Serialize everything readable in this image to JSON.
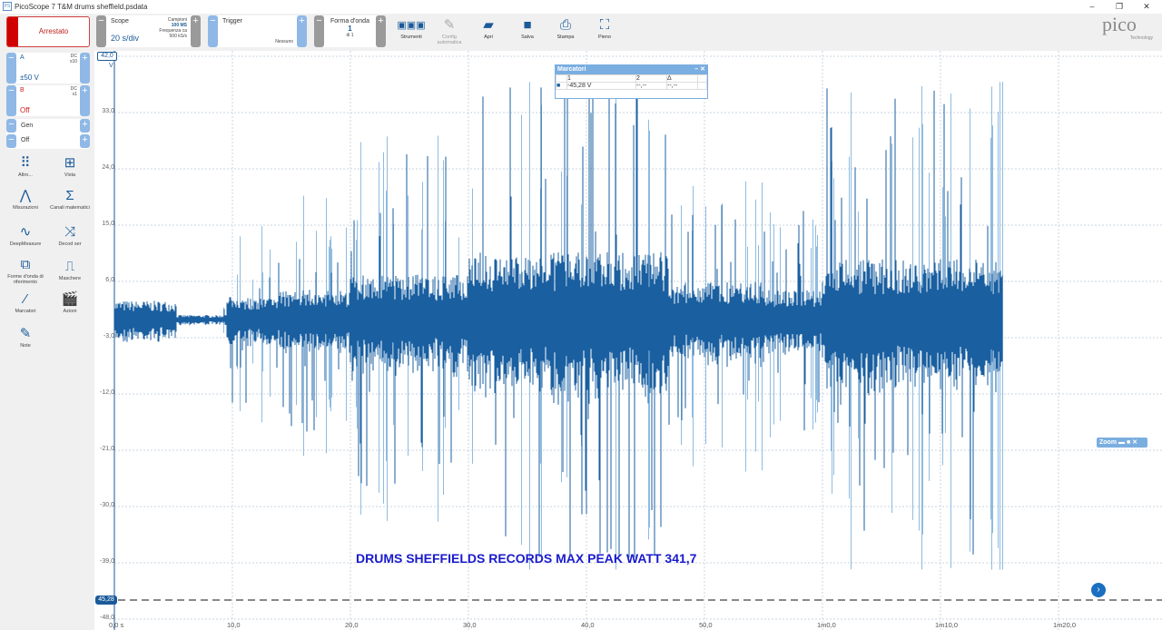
{
  "window": {
    "title": "PicoScope 7 T&M drums sheffield.psdata",
    "minimize": "–",
    "maximize": "❐",
    "close": "✕"
  },
  "toolbar": {
    "status": "Arrestato",
    "scope": {
      "label": "Scope",
      "value": "20 s/div",
      "samples_label": "Campioni",
      "samples": "100 MS",
      "rate_label": "Frequenza ca",
      "rate": "500 kS/s"
    },
    "trigger": {
      "label": "Trigger",
      "value": "Nessuno"
    },
    "waveform": {
      "label": "Forma d'onda",
      "value": "1",
      "of": "di 1"
    },
    "tools": [
      {
        "label": "Strumenti",
        "icon": "instruments-icon"
      },
      {
        "label": "Config automatica",
        "icon": "auto-setup-icon"
      },
      {
        "label": "Apri",
        "icon": "folder-icon"
      },
      {
        "label": "Salva",
        "icon": "save-icon"
      },
      {
        "label": "Stampa",
        "icon": "print-icon"
      },
      {
        "label": "Pieno",
        "icon": "fullscreen-icon"
      }
    ],
    "logo": "pico",
    "logo_sub": "Technology"
  },
  "channels": [
    {
      "name": "A",
      "coupling": "DC",
      "probe": "x10",
      "range": "±50 V",
      "color": "#1a5a99"
    },
    {
      "name": "B",
      "coupling": "DC",
      "probe": "x1",
      "range": "Off",
      "color": "#d02020"
    }
  ],
  "generator": {
    "label": "Gen",
    "value": "Off"
  },
  "sidebar": [
    {
      "label": "Altro...",
      "icon": "grid-dots-icon"
    },
    {
      "label": "Vista",
      "icon": "view-icon"
    },
    {
      "label": "Misurazioni",
      "icon": "compass-icon"
    },
    {
      "label": "Canali matematici",
      "icon": "sigma-icon"
    },
    {
      "label": "DeepMeasure",
      "icon": "deepmeasure-icon"
    },
    {
      "label": "Decod ser",
      "icon": "serial-decode-icon"
    },
    {
      "label": "Forme d'onda di riferimento",
      "icon": "reference-icon"
    },
    {
      "label": "Maschere",
      "icon": "mask-icon"
    },
    {
      "label": "Marcatori",
      "icon": "ruler-icon"
    },
    {
      "label": "Azioni",
      "icon": "clapper-icon"
    },
    {
      "label": "Note",
      "icon": "note-icon"
    }
  ],
  "plot": {
    "y_unit": "V",
    "y_top": "42,0",
    "y_ticks": [
      "33,0",
      "24,0",
      "15,0",
      "6,0",
      "-3,0",
      "-12,0",
      "-21,0",
      "-30,0",
      "-39,0",
      "-48,0"
    ],
    "x_ticks": [
      "0,0 s",
      "10,0",
      "20,0",
      "30,0",
      "40,0",
      "50,0",
      "1m0,0",
      "1m10,0",
      "1m20,0"
    ],
    "trace_color": "#1a5fa0",
    "trace_light": "#8fbbe0",
    "marker_value": "45,28",
    "annotation": "DRUMS SHEFFIELDS RECORDS MAX PEAK WATT 341,7"
  },
  "markers": {
    "title": "Marcatori",
    "cols": [
      "1",
      "2",
      "Δ"
    ],
    "row": [
      "-45,28 V",
      "--,--",
      "--,--"
    ]
  },
  "zoom": {
    "label": "Zoom"
  }
}
